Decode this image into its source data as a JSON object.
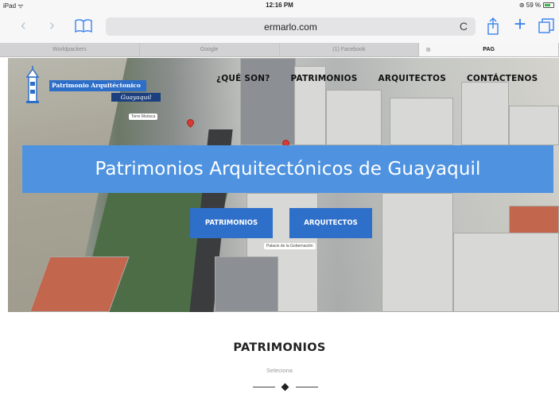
{
  "status": {
    "device": "iPad ᯤ",
    "time": "12:16 PM",
    "battery": "⊛ 59 %"
  },
  "browser": {
    "url": "ermarlo.com",
    "reload_icon": "C",
    "tabs": [
      {
        "label": "Worldpackers"
      },
      {
        "label": "Google"
      },
      {
        "label": "(1) Facebook"
      },
      {
        "label": "PAG",
        "close": "⊗"
      }
    ]
  },
  "site": {
    "logo_name": "Patrimonio Arquitéctonico",
    "logo_city": "Guayaquil",
    "menu": [
      "¿QUÉ SON?",
      "PATRIMONIOS",
      "ARQUITECTOS",
      "CONTÁCTENOS"
    ],
    "map_labels": [
      "Torre Morisca",
      "Palacio de la Gobernación"
    ],
    "hero_title": "Patrimonios Arquitectónicos de Guayaquil",
    "buttons": [
      "PATRIMONIOS",
      "ARQUITECTOS"
    ],
    "section_title": "PATRIMONIOS",
    "section_subtitle": "Seleciona"
  },
  "colors": {
    "banner": "#4f93e0",
    "button": "#2e6fca",
    "ios_blue": "#3b83f0"
  }
}
